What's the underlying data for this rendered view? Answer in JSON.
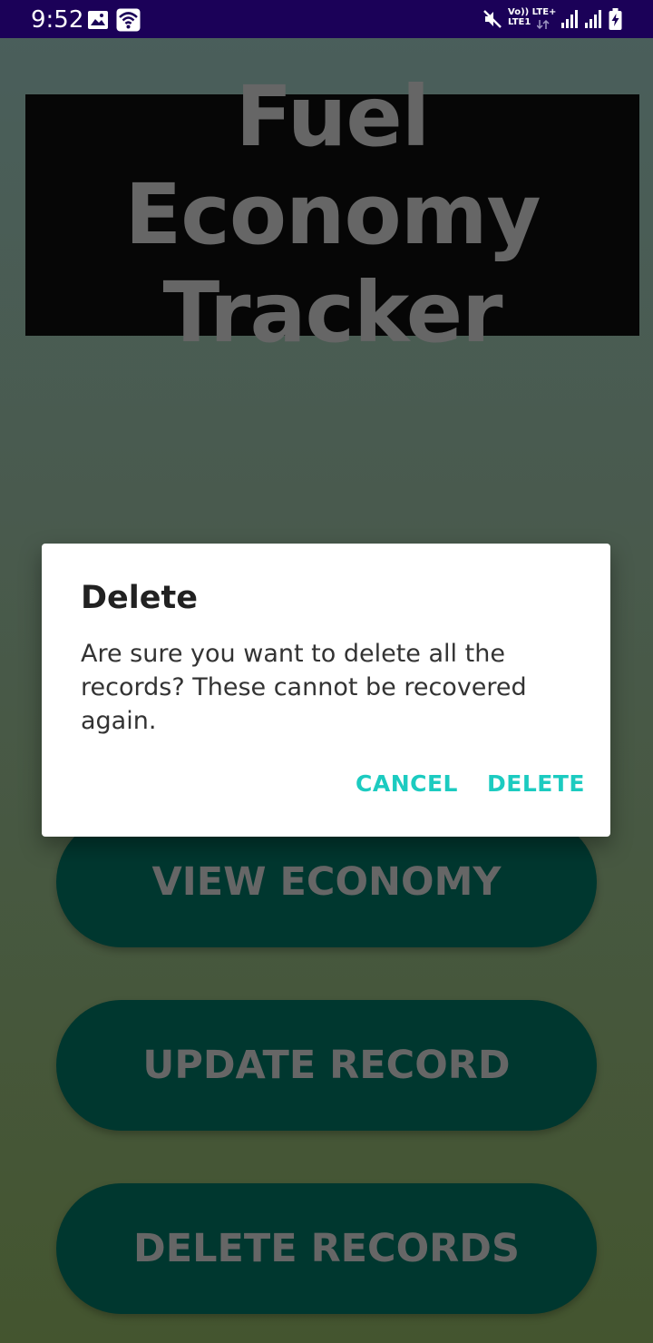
{
  "status_bar": {
    "time": "9:52",
    "network_top": "Vo)) LTE+",
    "network_bottom": "LTE1",
    "icons": [
      "gallery-icon",
      "wifi-icon",
      "mute-icon",
      "signal-icon",
      "signal-icon",
      "battery-charging-icon"
    ]
  },
  "app": {
    "title": "Fuel Economy Tracker",
    "colors": {
      "banner_bg": "#060606",
      "title_text": "#666666",
      "button_bg": "#00372f",
      "accent": "#1ccbc0"
    }
  },
  "buttons": {
    "view_economy": "VIEW ECONOMY",
    "update_record": "UPDATE RECORD",
    "delete_records": "DELETE RECORDS"
  },
  "dialog": {
    "title": "Delete",
    "message": "Are sure you want to delete all the records? These cannot be recovered again.",
    "cancel_label": "CANCEL",
    "delete_label": "DELETE"
  }
}
